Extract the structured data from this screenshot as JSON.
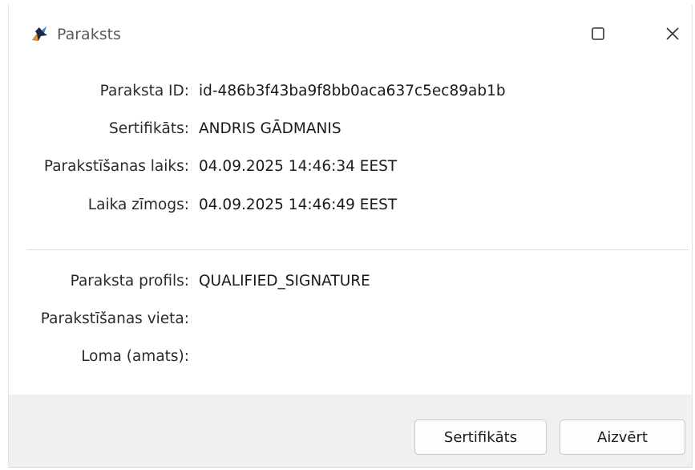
{
  "window": {
    "title": "Paraksts",
    "icon": "signature-app-icon",
    "maximize_icon": "maximize-icon",
    "close_icon": "close-icon"
  },
  "details": [
    {
      "label": "Paraksta ID:",
      "value": "id-486b3f43ba9f8bb0aca637c5ec89ab1b"
    },
    {
      "label": "Sertifikāts:",
      "value": "ANDRIS GĀDMANIS"
    },
    {
      "label": "Parakstīšanas laiks:",
      "value": "04.09.2025 14:46:34 EEST"
    },
    {
      "label": "Laika zīmogs:",
      "value": "04.09.2025 14:46:49 EEST"
    }
  ],
  "extra": [
    {
      "label": "Paraksta profils:",
      "value": "QUALIFIED_SIGNATURE"
    },
    {
      "label": "Parakstīšanas vieta:",
      "value": ""
    },
    {
      "label": "Loma (amats):",
      "value": ""
    }
  ],
  "buttons": {
    "certificate": "Sertifikāts",
    "close": "Aizvērt"
  }
}
